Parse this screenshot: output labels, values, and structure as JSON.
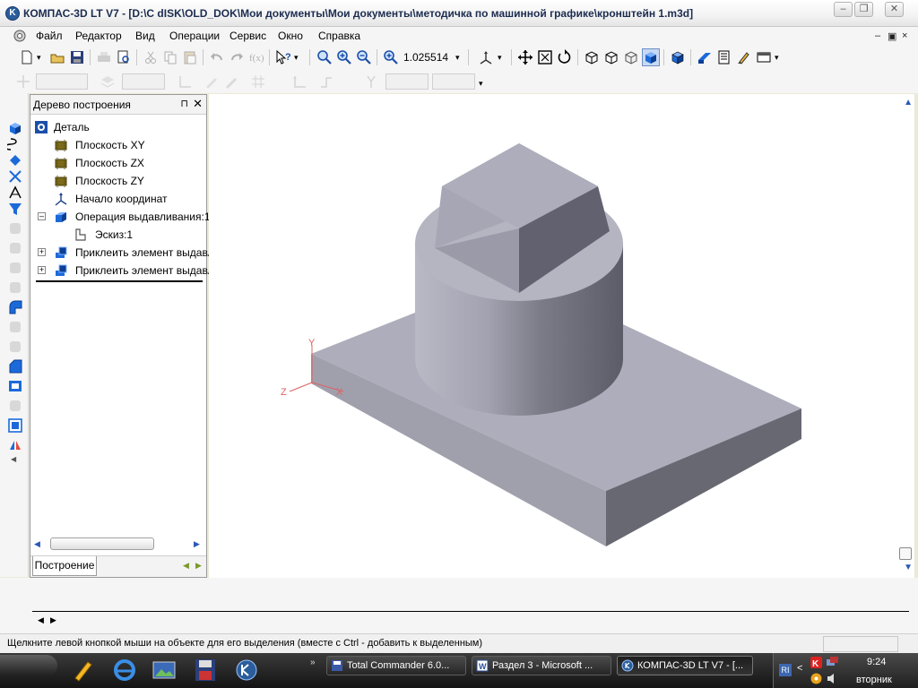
{
  "window": {
    "logo": "K",
    "title": "КОМПАС-3D LT V7 - [D:\\C dISK\\OLD_DOK\\Мои документы\\Мои документы\\методичка по машинной графике\\кронштейн 1.m3d]",
    "minimize_glyph": "–",
    "restore_glyph": "❐",
    "close_glyph": "✕"
  },
  "menu": {
    "items": [
      "Файл",
      "Редактор",
      "Вид",
      "Операции",
      "Сервис",
      "Окно",
      "Справка"
    ],
    "mdi_min": "–",
    "mdi_restore": "▣",
    "mdi_close": "×"
  },
  "toolbar": {
    "zoom_value": "1.025514",
    "dropdown_glyph": "▾"
  },
  "tree_panel": {
    "caption": "Дерево построения",
    "pin_glyph": "⊓",
    "close_glyph": "✕",
    "nodes": [
      {
        "label": "Деталь"
      },
      {
        "label": "Плоскость XY"
      },
      {
        "label": "Плоскость ZX"
      },
      {
        "label": "Плоскость ZY"
      },
      {
        "label": "Начало координат"
      },
      {
        "label": "Операция выдавливания:1"
      },
      {
        "label": "Эскиз:1"
      },
      {
        "label": "Приклеить элемент выдавл"
      },
      {
        "label": "Приклеить элемент выдавл"
      }
    ],
    "expand_minus": "–",
    "expand_plus": "+",
    "tab_label": "Построение",
    "left_arrow": "◀",
    "right_arrow": "▶"
  },
  "viewport": {
    "axis_y": "Y",
    "axis_x": "X",
    "axis_z": "Z",
    "axis_color": "#e06060",
    "up_arrow": "▲",
    "down_arrow": "▼"
  },
  "property_bar": {
    "left_arrow": "◀",
    "right_arrow": "▶"
  },
  "status": {
    "message": "Щелкните левой кнопкой мыши на объекте для его выделения (вместе с Ctrl - добавить к выделенным)"
  },
  "taskbar": {
    "overflow_glyph": "»",
    "tasks": [
      {
        "label": "Total Commander 6.0..."
      },
      {
        "label": "Раздел 3 - Microsoft ..."
      },
      {
        "label": "КОМПАС-3D LT V7 - [..."
      }
    ],
    "lang": "RI",
    "tray_chevron": "<",
    "time": "9:24",
    "day": "вторник"
  }
}
